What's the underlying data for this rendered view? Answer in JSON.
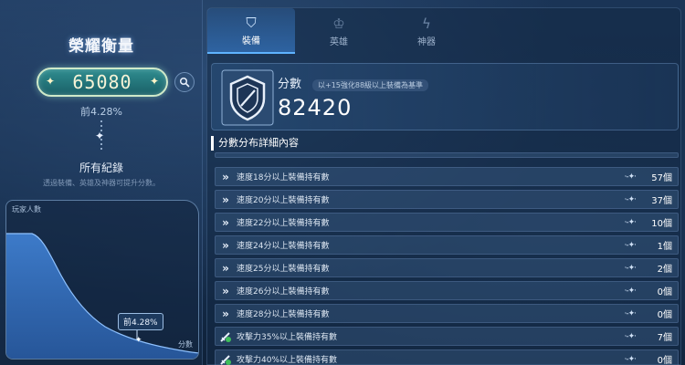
{
  "left": {
    "title": "榮耀衡量",
    "score": "65080",
    "rank": "前4.28%",
    "records_title": "所有紀錄",
    "records_desc": "透過裝備、英雄及神器可提升分數。",
    "graph": {
      "ylabel": "玩家人數",
      "xlabel": "分數",
      "marker_label": "前4.28%",
      "marker_percentile": 4.28
    }
  },
  "tabs": [
    {
      "label": "裝備",
      "icon": "equipment-icon",
      "active": true
    },
    {
      "label": "英雄",
      "icon": "hero-icon",
      "active": false
    },
    {
      "label": "神器",
      "icon": "artifact-icon",
      "active": false
    }
  ],
  "score_card": {
    "label": "分數",
    "note": "以+15強化88級以上裝備為基準",
    "value": "82420"
  },
  "section_title": "分數分布詳細內容",
  "rows": [
    {
      "label": "速度18分以上裝備持有數",
      "count": "57個",
      "icon": "speed-arrow-icon"
    },
    {
      "label": "速度20分以上裝備持有數",
      "count": "37個",
      "icon": "speed-arrow-icon"
    },
    {
      "label": "速度22分以上裝備持有數",
      "count": "10個",
      "icon": "speed-arrow-icon"
    },
    {
      "label": "速度24分以上裝備持有數",
      "count": "1個",
      "icon": "speed-arrow-icon"
    },
    {
      "label": "速度25分以上裝備持有數",
      "count": "2個",
      "icon": "speed-arrow-icon"
    },
    {
      "label": "速度26分以上裝備持有數",
      "count": "0個",
      "icon": "speed-arrow-icon"
    },
    {
      "label": "速度28分以上裝備持有數",
      "count": "0個",
      "icon": "speed-arrow-icon"
    },
    {
      "label": "攻擊力35%以上裝備持有數",
      "count": "7個",
      "icon": "attack-sword-icon"
    },
    {
      "label": "攻擊力40%以上裝備持有數",
      "count": "0個",
      "icon": "attack-sword-icon"
    }
  ],
  "colors": {
    "accent": "#5fb3ff",
    "pill": "#2f8d8f",
    "background": "#0e2036"
  }
}
